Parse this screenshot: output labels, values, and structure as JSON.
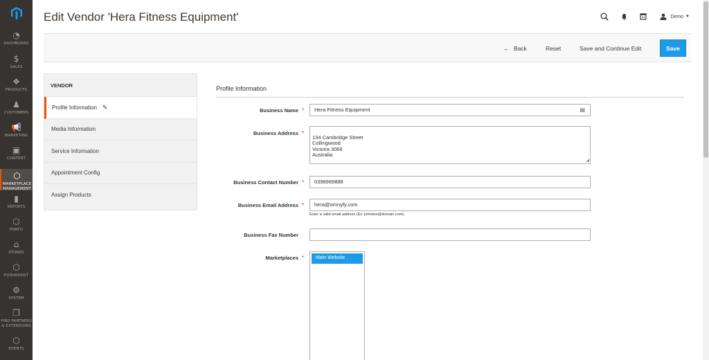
{
  "nav": {
    "items": [
      {
        "label": "Dashboard",
        "icon": "speedometer-icon",
        "glyph": "◔"
      },
      {
        "label": "Sales",
        "icon": "dollar-icon",
        "glyph": "$"
      },
      {
        "label": "Products",
        "icon": "cube-icon",
        "glyph": "❖"
      },
      {
        "label": "Customers",
        "icon": "person-icon",
        "glyph": "♟"
      },
      {
        "label": "Marketing",
        "icon": "megaphone-icon",
        "glyph": "📢"
      },
      {
        "label": "Content",
        "icon": "layout-icon",
        "glyph": "▣"
      },
      {
        "label": "Marketplace Management",
        "icon": "hexagon-icon",
        "glyph": "⬡"
      },
      {
        "label": "Reports",
        "icon": "bar-chart-icon",
        "glyph": "▮"
      },
      {
        "label": "Porto",
        "icon": "hexagon-icon",
        "glyph": "⬡"
      },
      {
        "label": "Stores",
        "icon": "storefront-icon",
        "glyph": "⌂"
      },
      {
        "label": "Pushassist",
        "icon": "hexagon-icon",
        "glyph": "⬡"
      },
      {
        "label": "System",
        "icon": "gear-icon",
        "glyph": "⚙"
      },
      {
        "label": "Find Partners & Extensions",
        "icon": "boxes-icon",
        "glyph": "❒"
      },
      {
        "label": "Events",
        "icon": "hexagon-icon",
        "glyph": "⬡"
      }
    ],
    "active_index": 6
  },
  "header": {
    "title": "Edit Vendor 'Hera Fitness Equipment'",
    "user_name": "Demo"
  },
  "actions": {
    "back": "Back",
    "reset": "Reset",
    "save_continue": "Save and Continue Edit",
    "save": "Save"
  },
  "tabs": {
    "heading": "Vendor",
    "items": [
      "Profile Information",
      "Media Information",
      "Service Information",
      "Appointment Config",
      "Assign Products"
    ]
  },
  "form": {
    "section_title": "Profile Information",
    "business_name": {
      "label": "Business Name",
      "value": "Hera Fitness Equipment"
    },
    "business_address": {
      "label": "Business Address",
      "value": "134 Cambridge Street\nCollingwood\nVictoria 3066\nAustralia"
    },
    "contact_number": {
      "label": "Business Contact Number",
      "value": "0398989888"
    },
    "email": {
      "label": "Business Email Address",
      "value": "hera@omnyfy.com",
      "note": "Enter a valid email address (Ex: johndoe@domain.com)."
    },
    "fax": {
      "label": "Business Fax Number",
      "value": ""
    },
    "marketplaces": {
      "label": "Marketplaces",
      "options": [
        "Main Website"
      ]
    }
  },
  "colors": {
    "nav_bg": "#373330",
    "accent_orange": "#eb5202",
    "primary_blue": "#1e9be8",
    "required_red": "#e22626"
  }
}
